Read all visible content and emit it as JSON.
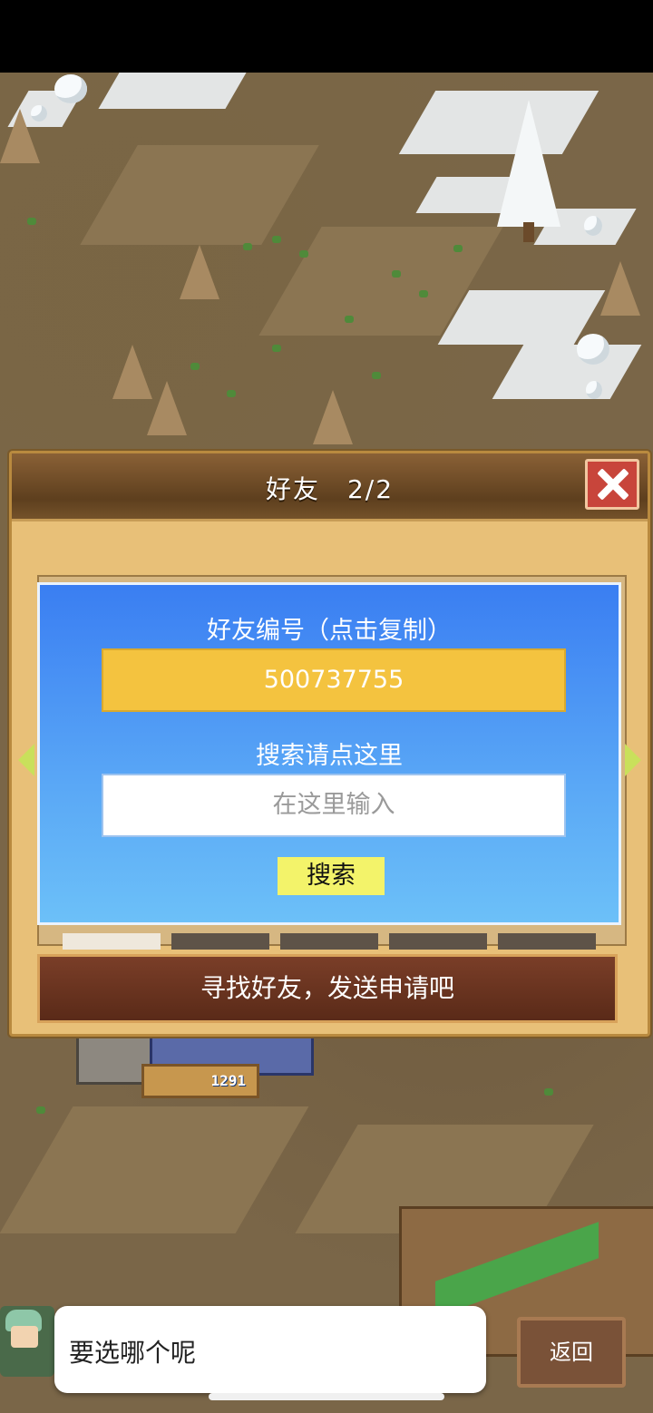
{
  "dialog": {
    "title": "好友　2/2",
    "friend_id_label": "好友编号（点击复制）",
    "friend_id": "500737755",
    "search_label": "搜索请点这里",
    "search_placeholder": "在这里输入",
    "search_button": "搜索",
    "find_friends_button": "寻找好友，发送申请吧"
  },
  "map": {
    "sign_value": "1291"
  },
  "bottom": {
    "speech_text": "要选哪个呢",
    "back_button": "返回"
  },
  "colors": {
    "panel_blue": "#3a7ef2",
    "id_box_yellow": "#f4c33f",
    "search_button_yellow": "#f3f36a",
    "close_red": "#c8453b"
  },
  "icons": {
    "close": "close-x-icon",
    "left": "arrow-left-icon",
    "right": "arrow-right-icon"
  }
}
